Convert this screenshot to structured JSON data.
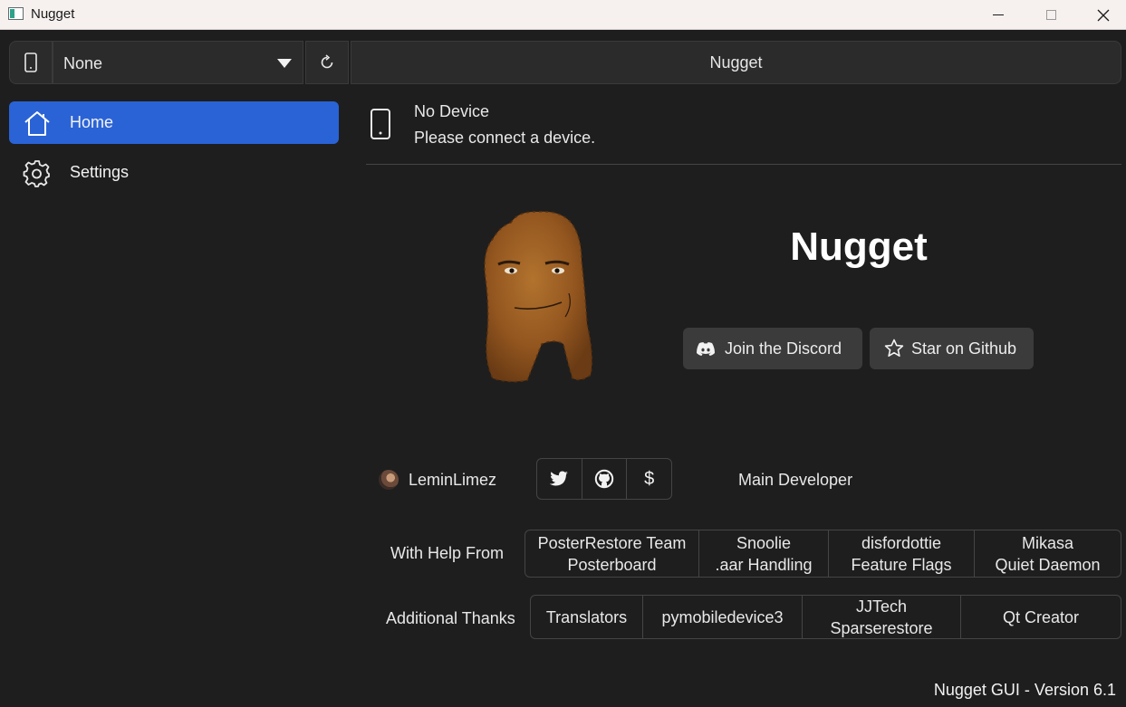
{
  "window": {
    "title": "Nugget"
  },
  "topbar": {
    "device_select_value": "None",
    "app_title": "Nugget"
  },
  "sidebar": {
    "items": [
      {
        "label": "Home",
        "icon": "home-icon",
        "active": true
      },
      {
        "label": "Settings",
        "icon": "gear-icon",
        "active": false
      }
    ]
  },
  "device": {
    "name": "No Device",
    "status": "Please connect a device."
  },
  "hero": {
    "app_name": "Nugget",
    "discord_label": "Join the Discord",
    "github_label": "Star on Github"
  },
  "developer": {
    "handle": "LeminLimez",
    "role": "Main Developer",
    "links": [
      "twitter-icon",
      "github-icon",
      "$"
    ]
  },
  "help": {
    "label": "With Help From",
    "credits": [
      {
        "name": "PosterRestore Team",
        "role": "Posterboard"
      },
      {
        "name": "Snoolie",
        "role": ".aar Handling"
      },
      {
        "name": "disfordottie",
        "role": "Feature Flags"
      },
      {
        "name": "Mikasa",
        "role": "Quiet Daemon"
      }
    ]
  },
  "thanks": {
    "label": "Additional Thanks",
    "credits": [
      {
        "name": "Translators"
      },
      {
        "name": "pymobiledevice3"
      },
      {
        "name": "JJTech",
        "role": "Sparserestore"
      },
      {
        "name": "Qt Creator"
      }
    ]
  },
  "footer": {
    "version": "Nugget GUI - Version 6.1"
  },
  "colors": {
    "accent": "#2a63d6",
    "background": "#1e1e1e",
    "button": "#3b3b3b"
  }
}
